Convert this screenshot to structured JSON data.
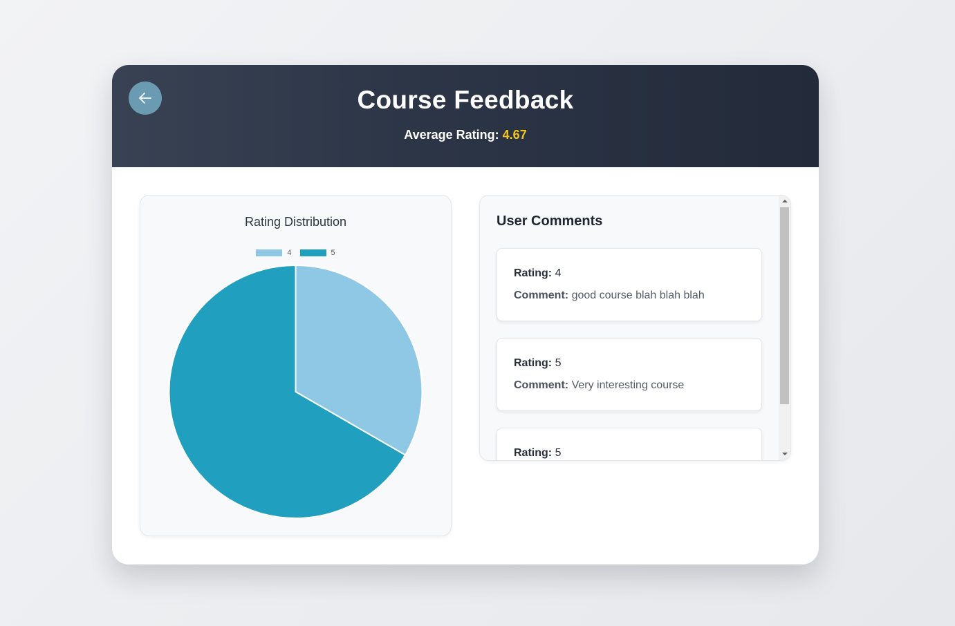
{
  "header": {
    "title": "Course Feedback",
    "average_label": "Average Rating:",
    "average_value": "4.67",
    "back_icon": "arrow-left-icon"
  },
  "chart": {
    "title": "Rating Distribution"
  },
  "chart_data": {
    "type": "pie",
    "title": "Rating Distribution",
    "categories": [
      "4",
      "5"
    ],
    "values": [
      1,
      2
    ],
    "colors": [
      "#8fc8e4",
      "#219fbe"
    ],
    "legend_position": "top"
  },
  "comments": {
    "title": "User Comments",
    "rating_label": "Rating:",
    "comment_label": "Comment:",
    "items": [
      {
        "rating": "4",
        "comment": "good course blah blah blah"
      },
      {
        "rating": "5",
        "comment": "Very interesting course"
      },
      {
        "rating": "5",
        "comment": ""
      }
    ]
  },
  "colors": {
    "accent": "#f5c518",
    "back_button": "#6a9bb3",
    "header_dark": "#232b3a"
  }
}
